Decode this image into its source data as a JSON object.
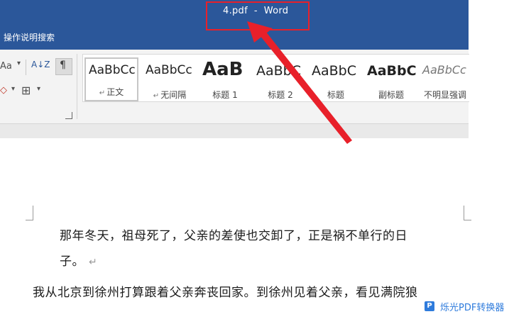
{
  "window": {
    "title": "4.pdf  -  Word",
    "tell_me": "操作说明搜索"
  },
  "ribbon": {
    "font_controls": {
      "change_case_icon": "Aa",
      "sort_icon": "A↓Z",
      "pilcrow_icon": "¶",
      "shading_icon": "◇",
      "borders_icon": "⊞"
    },
    "styles": [
      {
        "preview": "AaBbCc",
        "label": "正文",
        "selected": true
      },
      {
        "preview": "AaBbCc",
        "label": "无间隔",
        "selected": false
      },
      {
        "preview": "AaB",
        "label": "标题 1",
        "selected": false
      },
      {
        "preview": "AaBbC",
        "label": "标题 2",
        "selected": false
      },
      {
        "preview": "AaBbC",
        "label": "标题",
        "selected": false
      },
      {
        "preview": "AaBbC",
        "label": "副标题",
        "selected": false
      },
      {
        "preview": "AaBbCc",
        "label": "不明显强调",
        "selected": false
      }
    ]
  },
  "document": {
    "lines": [
      "那年冬天，祖母死了，父亲的差使也交卸了，正是祸不单行的日",
      "子。",
      "我从北京到徐州打算跟着父亲奔丧回家。到徐州见着父亲，看见满院狼"
    ],
    "paragraph_mark": "↵"
  },
  "watermark": {
    "text": "烁光PDF转换器"
  },
  "colors": {
    "title_bar": "#2b579a",
    "highlight": "#e8202a",
    "watermark": "#2e7bdc"
  }
}
